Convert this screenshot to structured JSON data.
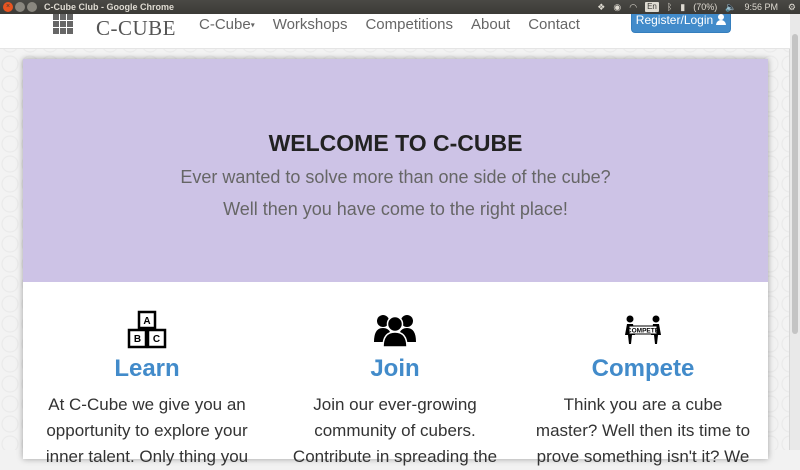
{
  "os": {
    "window_title": "C-Cube Club - Google Chrome",
    "lang": "En",
    "battery": "(70%)",
    "time": "9:56 PM"
  },
  "nav": {
    "brand": "C-CUBE",
    "links": [
      "C-Cube",
      "Workshops",
      "Competitions",
      "About",
      "Contact"
    ],
    "register": "Register/Login"
  },
  "hero": {
    "title": "WELCOME TO C-CUBE",
    "line1": "Ever wanted to solve more than one side of the cube?",
    "line2": "Well then you have come to the right place!"
  },
  "features": [
    {
      "icon": "abc-blocks-icon",
      "title": "Learn",
      "text": "At C-Cube we give you an opportunity to explore your inner talent. Only thing you"
    },
    {
      "icon": "group-icon",
      "title": "Join",
      "text": "Join our ever-growing community of cubers. Contribute in spreading the"
    },
    {
      "icon": "compete-icon",
      "title": "Compete",
      "text": "Think you are a cube master? Well then its time to prove something isn't it? We",
      "icon_text": "COMPETE"
    }
  ],
  "colors": {
    "accent": "#428bca",
    "hero_bg": "#cdc3e6"
  }
}
